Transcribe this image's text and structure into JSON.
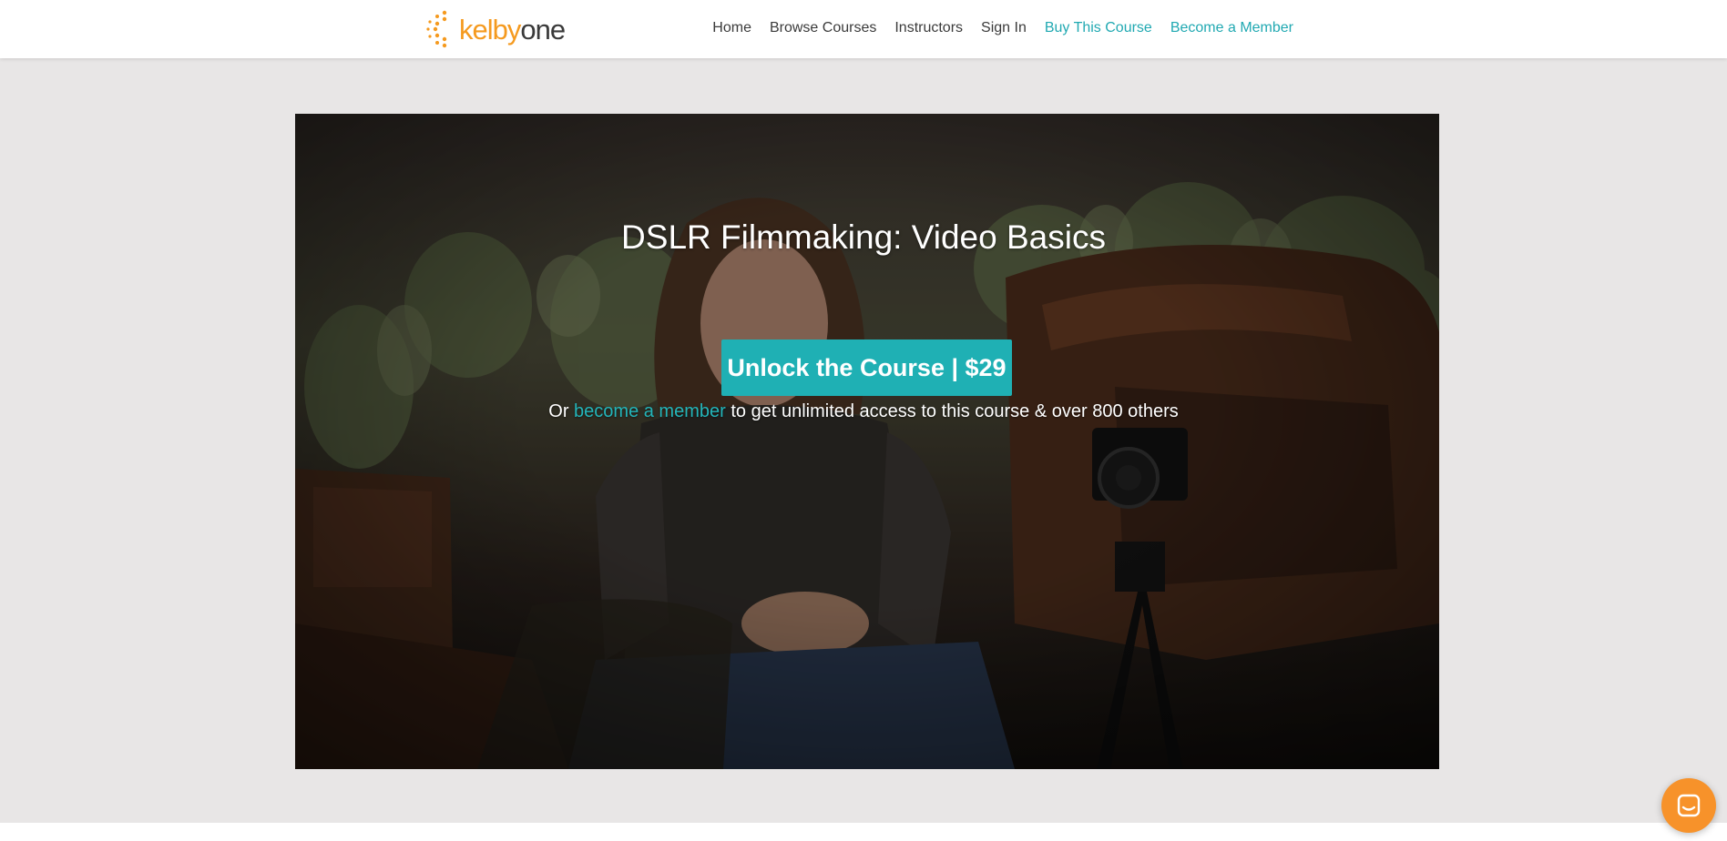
{
  "brand": {
    "logo_kelby": "kelby",
    "logo_one": "one",
    "colors": {
      "orange": "#f59a1f",
      "teal": "#1fb0b4",
      "dark": "#3a3a3a"
    }
  },
  "nav": {
    "items": [
      {
        "label": "Home"
      },
      {
        "label": "Browse Courses"
      },
      {
        "label": "Instructors"
      },
      {
        "label": "Sign In"
      },
      {
        "label": "Buy This Course"
      },
      {
        "label": "Become a Member"
      }
    ]
  },
  "hero": {
    "title": "DSLR Filmmaking: Video Basics",
    "cta_label": "Unlock the Course | $29",
    "sub_prefix": "Or",
    "sub_link": "become a member",
    "sub_suffix": "to get unlimited access to this course & over 800 others"
  },
  "chat": {
    "icon": "chat-icon"
  }
}
